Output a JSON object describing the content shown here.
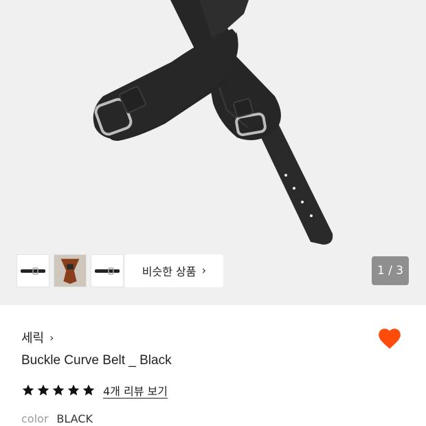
{
  "gallery": {
    "similar_label": "비슷한 상품",
    "similar_chevron": "›",
    "page_indicator": "1 / 3",
    "thumbnails": [
      {
        "icon": "belt-thumbnail-icon"
      },
      {
        "icon": "brown-belt-thumbnail-icon"
      },
      {
        "icon": "belt-thumbnail-icon"
      }
    ]
  },
  "product": {
    "brand": "세릭",
    "brand_chevron": "›",
    "title": "Buckle Curve Belt _ Black",
    "rating_stars": 5,
    "rating_max": 5,
    "review_link": "4개 리뷰 보기",
    "color_label": "color",
    "color_value": "BLACK",
    "favorited": true
  },
  "colors": {
    "heart": "#ff4c0a",
    "indicator_bg": "#8f8f8f",
    "hero_bg": "#f0f0f0"
  }
}
